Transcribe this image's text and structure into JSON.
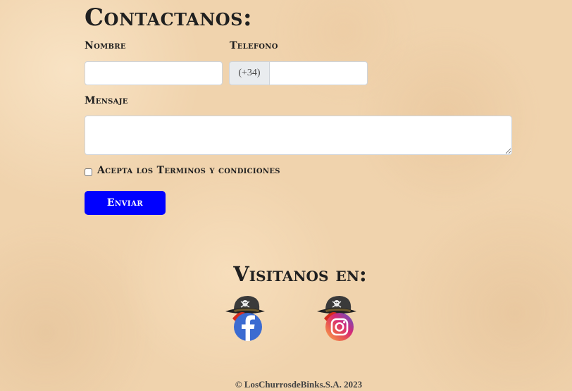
{
  "contact": {
    "title": "Contactanos:",
    "name_label": "Nombre",
    "name_value": "",
    "phone_label": "Telefono",
    "phone_prefix": "(+34)",
    "phone_value": "",
    "message_label": "Mensaje",
    "message_value": "",
    "terms_label": "Acepta los Terminos y condiciones",
    "terms_checked": false,
    "submit_label": "Enviar"
  },
  "social": {
    "title": "Visitanos en:",
    "links": [
      {
        "name": "facebook",
        "icon": "facebook-pirate-icon",
        "color": "#3b6bd1"
      },
      {
        "name": "instagram",
        "icon": "instagram-pirate-icon",
        "color": "#d62976"
      }
    ]
  },
  "footer": {
    "text": "© LosChurrosdeBinks.S.A. 2023"
  },
  "colors": {
    "accent": "#0000ff",
    "background": "#f0d3ad"
  }
}
